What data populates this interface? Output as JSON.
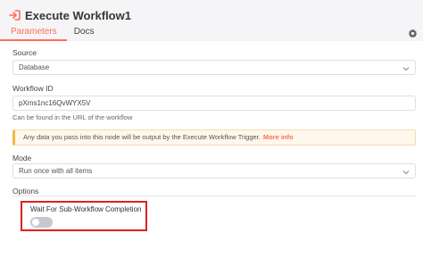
{
  "header": {
    "title": "Execute Workflow1",
    "icon": "sign-in-icon",
    "accent_color": "#ff6d5a"
  },
  "tabs": [
    {
      "label": "Parameters",
      "active": true
    },
    {
      "label": "Docs",
      "active": false
    }
  ],
  "fields": {
    "source": {
      "label": "Source",
      "value": "Database"
    },
    "workflow_id": {
      "label": "Workflow ID",
      "value": "pXms1nc16QvWYX5V",
      "hint": "Can be found in the URL of the workflow"
    },
    "notice": {
      "text": "Any data you pass into this node will be output by the Execute Workflow Trigger.",
      "link": "More info"
    },
    "mode": {
      "label": "Mode",
      "value": "Run once with all items"
    }
  },
  "options": {
    "label": "Options",
    "wait_label": "Wait For Sub-Workflow Completion",
    "wait_enabled": false
  }
}
